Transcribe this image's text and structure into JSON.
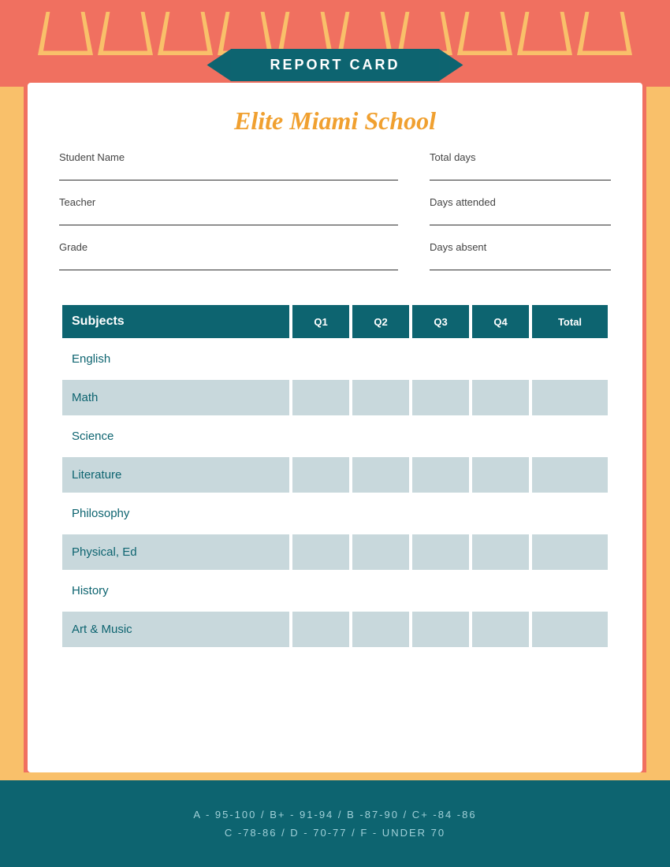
{
  "banner": {
    "title": "REPORT CARD"
  },
  "school": {
    "name": "Elite Miami School"
  },
  "form": {
    "student_name_label": "Student Name",
    "teacher_label": "Teacher",
    "grade_label": "Grade",
    "total_days_label": "Total days",
    "days_attended_label": "Days attended",
    "days_absent_label": "Days absent"
  },
  "table": {
    "headers": {
      "subjects": "Subjects",
      "q1": "Q1",
      "q2": "Q2",
      "q3": "Q3",
      "q4": "Q4",
      "total": "Total"
    },
    "subjects": [
      {
        "name": "English",
        "shaded": false
      },
      {
        "name": "Math",
        "shaded": true
      },
      {
        "name": "Science",
        "shaded": false
      },
      {
        "name": "Literature",
        "shaded": true
      },
      {
        "name": "Philosophy",
        "shaded": false
      },
      {
        "name": "Physical, Ed",
        "shaded": true
      },
      {
        "name": "History",
        "shaded": false
      },
      {
        "name": "Art & Music",
        "shaded": true
      }
    ]
  },
  "footer": {
    "line1": "A - 95-100 / B+ - 91-94 / B -87-90 / C+ -84 -86",
    "line2": "C -78-86 / D - 70-77 / F - UNDER 70"
  },
  "geo_shapes": [
    1,
    2,
    3,
    4,
    5,
    6,
    7,
    8,
    9,
    10
  ]
}
